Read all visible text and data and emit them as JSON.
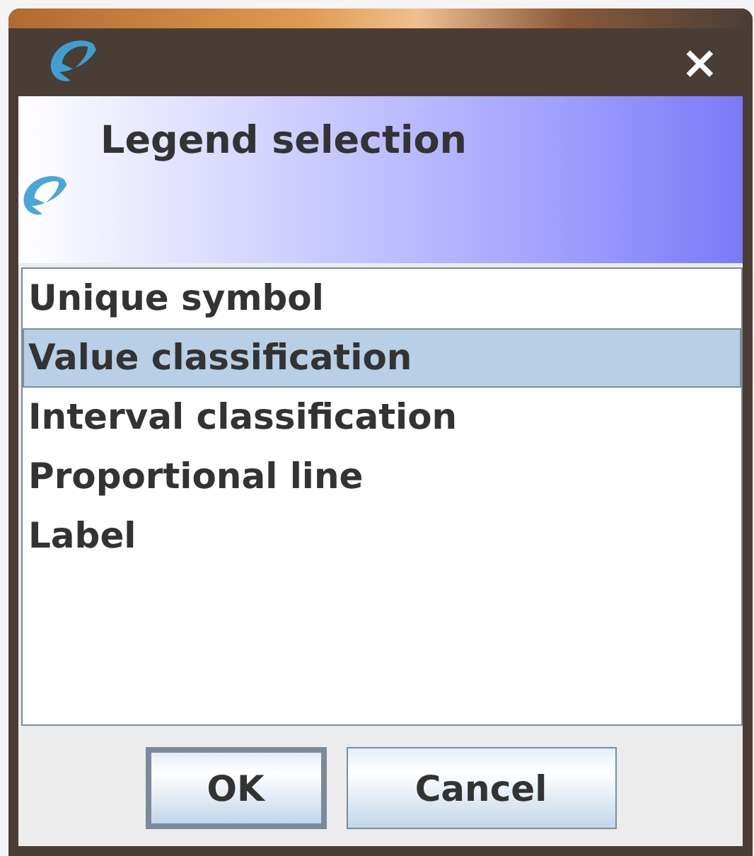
{
  "dialog": {
    "heading": "Legend selection"
  },
  "legend_types": [
    {
      "label": "Unique symbol",
      "selected": false
    },
    {
      "label": "Value classification",
      "selected": true
    },
    {
      "label": "Interval classification",
      "selected": false
    },
    {
      "label": "Proportional line",
      "selected": false
    },
    {
      "label": "Label",
      "selected": false
    }
  ],
  "buttons": [
    {
      "label": "OK",
      "default": true
    },
    {
      "label": "Cancel",
      "default": false
    }
  ],
  "close_button": {
    "label": "×"
  }
}
